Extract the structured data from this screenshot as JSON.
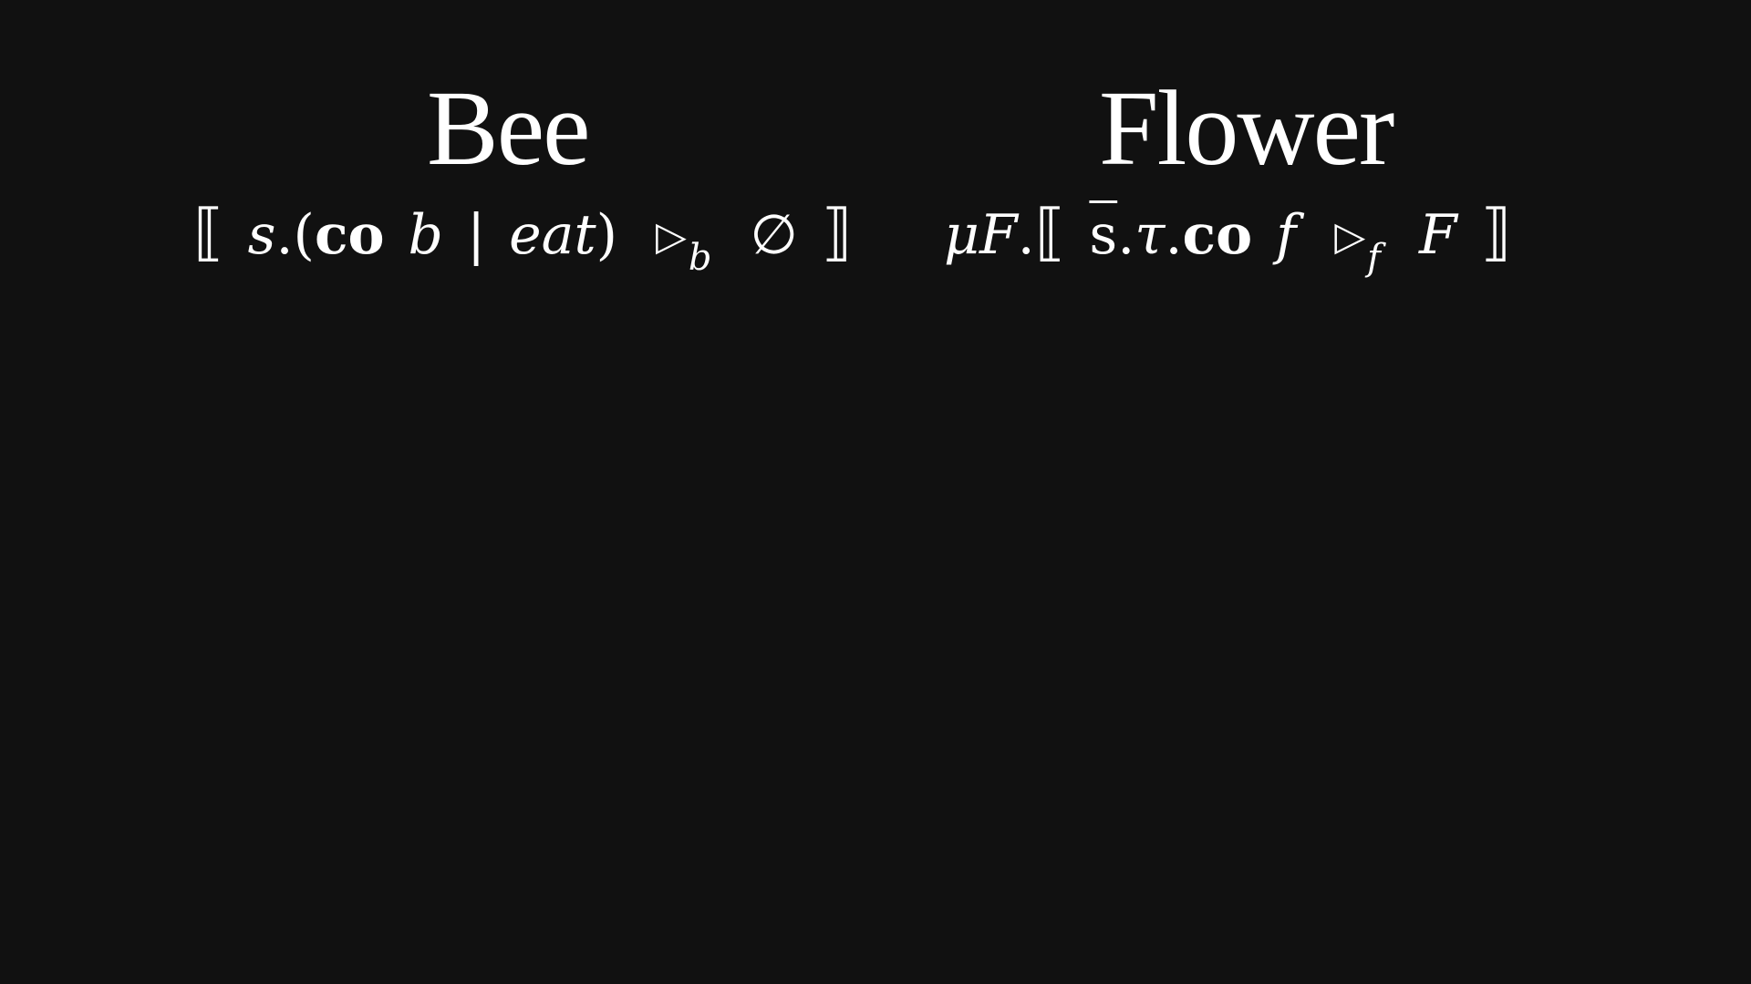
{
  "bee": {
    "title": "Bee",
    "formula": {
      "open": "⟦",
      "s": "s",
      "dot1": ".",
      "lparen": "(",
      "co": "co",
      "b": "b",
      "pipe": "|",
      "eat": "eat",
      "rparen": ")",
      "tri": "▷",
      "sub": "b",
      "empty": "∅",
      "close": "⟧"
    }
  },
  "flower": {
    "title": "Flower",
    "formula": {
      "mu": "μ",
      "F1": "F",
      "dot1": ".",
      "open": "⟦",
      "sbar": "s",
      "dot2": ".",
      "tau": "τ",
      "dot3": ".",
      "co": "co",
      "f": "f",
      "tri": "▷",
      "sub": "f",
      "F2": "F",
      "close": "⟧"
    }
  }
}
